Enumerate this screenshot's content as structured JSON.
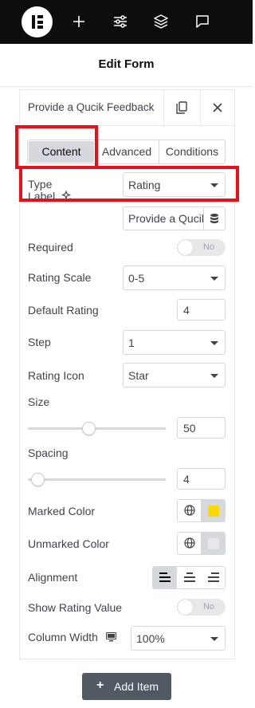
{
  "topbar": {
    "logo": "elementor-logo",
    "icons": [
      "plus-icon",
      "sliders-icon",
      "layers-icon",
      "chat-icon"
    ]
  },
  "page": {
    "title": "Edit Form"
  },
  "item": {
    "title": "Provide a Qucik Feedback"
  },
  "tabs": [
    "Content",
    "Advanced",
    "Conditions"
  ],
  "fields": {
    "type": {
      "label": "Type",
      "value": "Rating"
    },
    "label": {
      "label": "Label",
      "value": "Provide a Qucik Feedback"
    },
    "required": {
      "label": "Required",
      "value": "No"
    },
    "rating_scale": {
      "label": "Rating Scale",
      "value": "0-5"
    },
    "default_rating": {
      "label": "Default Rating",
      "value": "4"
    },
    "step": {
      "label": "Step",
      "value": "1"
    },
    "rating_icon": {
      "label": "Rating Icon",
      "value": "Star"
    },
    "size": {
      "label": "Size",
      "value": "50"
    },
    "spacing": {
      "label": "Spacing",
      "value": "4"
    },
    "marked_color": {
      "label": "Marked Color",
      "color": "#fad800"
    },
    "unmarked_color": {
      "label": "Unmarked Color",
      "color": "#e6e8ea"
    },
    "alignment": {
      "label": "Alignment",
      "selected": "left"
    },
    "show_rating_value": {
      "label": "Show Rating Value",
      "value": "No"
    },
    "column_width": {
      "label": "Column Width",
      "value": "100%"
    }
  },
  "add_item": {
    "label": "Add Item"
  },
  "colors": {
    "highlight": "#e8101b",
    "topbar": "#0c0d0e",
    "button": "#515962"
  }
}
